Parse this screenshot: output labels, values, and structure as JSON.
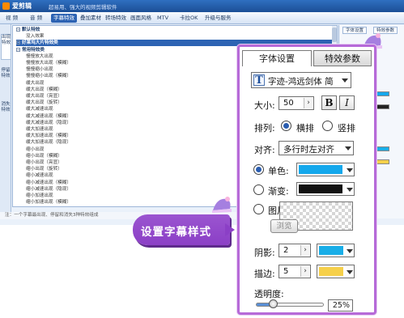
{
  "app": {
    "name": "爱剪辑",
    "slogan": "超易用、强大的视频剪辑软件"
  },
  "menu": {
    "items": [
      "视 频",
      "音 频",
      "字幕特效",
      "叠加素材",
      "转场特效",
      "画面风格",
      "MTV",
      "卡拉OK",
      "升级与服务"
    ],
    "active_index": 2
  },
  "side_tabs": [
    "出现特效",
    "停留特效",
    "消失特效"
  ],
  "tree": {
    "rows": [
      {
        "text": "默认特效",
        "level": 0,
        "group": true
      },
      {
        "text": "没入效果",
        "level": 1
      },
      {
        "text": "好莱坞大片特效类",
        "level": 0,
        "group": true,
        "selected": true
      },
      {
        "text": "常用特效类",
        "level": 0,
        "group": true
      },
      {
        "text": "慢慢放大出现",
        "level": 1
      },
      {
        "text": "慢慢放大出现（模糊）",
        "level": 1
      },
      {
        "text": "慢慢缩小出现",
        "level": 1
      },
      {
        "text": "慢慢缩小出现（模糊）",
        "level": 1
      },
      {
        "text": "缓大出现",
        "level": 1
      },
      {
        "text": "缓大出现（模糊）",
        "level": 1
      },
      {
        "text": "缓大出现（亮显）",
        "level": 1
      },
      {
        "text": "缓大出现（旋转）",
        "level": 1
      },
      {
        "text": "缓大减速出现",
        "level": 1
      },
      {
        "text": "缓大减速出现（模糊）",
        "level": 1
      },
      {
        "text": "缓大减速出现（隐现）",
        "level": 1
      },
      {
        "text": "缓大加速出现",
        "level": 1
      },
      {
        "text": "缓大加速出现（模糊）",
        "level": 1
      },
      {
        "text": "缓大加速出现（隐现）",
        "level": 1
      },
      {
        "text": "缩小出现",
        "level": 1
      },
      {
        "text": "缩小出现（模糊）",
        "level": 1
      },
      {
        "text": "缩小出现（亮显）",
        "level": 1
      },
      {
        "text": "缩小出现（旋转）",
        "level": 1
      },
      {
        "text": "缩小减速出现",
        "level": 1
      },
      {
        "text": "缩小减速出现（模糊）",
        "level": 1
      },
      {
        "text": "缩小减速出现（隐现）",
        "level": 1
      },
      {
        "text": "缩小加速出现",
        "level": 1
      },
      {
        "text": "缩小加速出现（模糊）",
        "level": 1
      }
    ]
  },
  "hint": "注：一个字幕最出现、停留和消失3种特效组成",
  "mini_panel": {
    "tabs": [
      "字体设置",
      "特效参数"
    ]
  },
  "panel": {
    "tabs": [
      "字体设置",
      "特效参数"
    ],
    "active_tab": 0,
    "font": {
      "icon": "T",
      "name": "字迹-鸿远剑体 简"
    },
    "size": {
      "label": "大小:",
      "value": "50",
      "bold": "B",
      "italic": "I"
    },
    "arrange": {
      "label": "排列:",
      "options": [
        "横排",
        "竖排"
      ],
      "selected": 0
    },
    "align": {
      "label": "对齐:",
      "value": "多行时左对齐"
    },
    "fill": {
      "solid": {
        "label": "单色:",
        "color": "#14a8ec"
      },
      "gradient": {
        "label": "渐变:",
        "color": "#111111"
      },
      "image": {
        "label": "图片:",
        "browse": "浏览"
      },
      "selected": "solid"
    },
    "shadow": {
      "label": "阴影:",
      "value": "2",
      "color": "#19aee8"
    },
    "stroke": {
      "label": "描边:",
      "value": "5",
      "color": "#f6d04a"
    },
    "opacity": {
      "label": "透明度:",
      "value": "25%",
      "level": 0.25
    }
  },
  "callout": {
    "text": "设置字幕样式",
    "color": "#8b3fc6"
  },
  "colors": {
    "accent": "#2d63b3",
    "frame": "#b66ad8"
  }
}
